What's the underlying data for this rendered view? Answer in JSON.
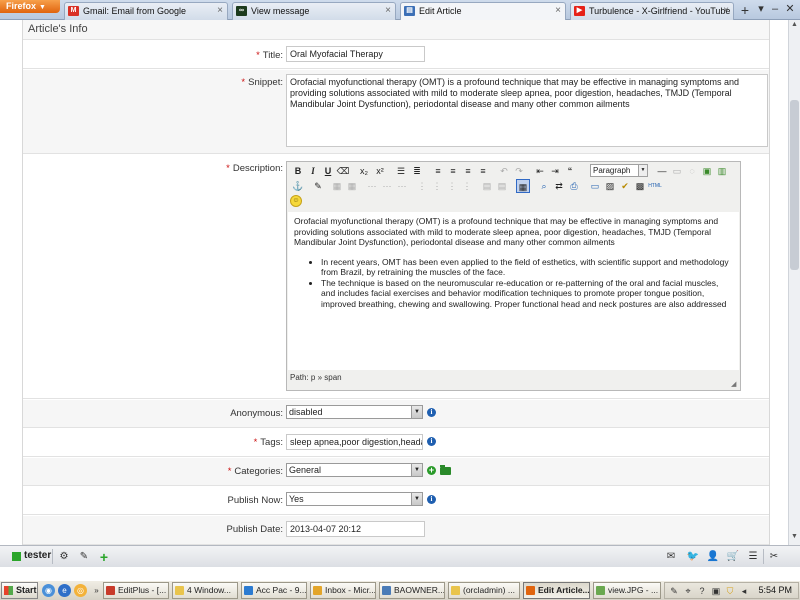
{
  "browser": {
    "menu_label": "Firefox",
    "tabs": [
      {
        "label": "Gmail: Email from Google"
      },
      {
        "label": "View message"
      },
      {
        "label": "Edit Article"
      },
      {
        "label": "Turbulence - X-Girlfriend - YouTube"
      }
    ],
    "new_tab_label": "+"
  },
  "form": {
    "section_title": "Article's Info",
    "required_mark": "*",
    "title": {
      "label": "Title:",
      "value": "Oral Myofacial Therapy"
    },
    "snippet": {
      "label": "Snippet:",
      "value": "Orofacial myofunctional therapy (OMT) is a profound technique that may be effective in managing symptoms and providing solutions associated with mild to moderate sleep apnea, poor digestion, headaches, TMJD (Temporal Mandibular Joint Dysfunction), periodontal disease and many other common ailments"
    },
    "description": {
      "label": "Description:",
      "format_select": "Paragraph",
      "paragraph": "Orofacial myofunctional therapy (OMT) is a profound technique that may be effective in managing symptoms and providing solutions associated with mild to moderate sleep apnea, poor digestion, headaches, TMJD (Temporal Mandibular Joint Dysfunction), periodontal disease and many other common ailments",
      "bullets": [
        "In recent years, OMT has been even applied to the field of esthetics, with scientific support and methodology from Brazil, by retraining the muscles of the face.",
        "The technique is based on the neuromuscular re-education or re-patterning of the oral and facial muscles, and includes facial exercises and behavior modification techniques to promote proper tongue position, improved breathing, chewing and swallowing. Proper functional head and neck postures are also addressed"
      ],
      "path": "Path: p » span"
    },
    "anonymous": {
      "label": "Anonymous:",
      "value": "disabled"
    },
    "tags": {
      "label": "Tags:",
      "value": "sleep apnea,poor digestion,headac"
    },
    "categories": {
      "label": "Categories:",
      "value": "General"
    },
    "publish_now": {
      "label": "Publish Now:",
      "value": "Yes"
    },
    "publish_date": {
      "label": "Publish Date:",
      "value": "2013-04-07 20:12"
    }
  },
  "addon_bar": {
    "user": "tester"
  },
  "taskbar": {
    "start": "Start",
    "items": [
      {
        "label": "EditPlus - [..."
      },
      {
        "label": "4 Window..."
      },
      {
        "label": "Acc Pac - 9..."
      },
      {
        "label": "Inbox - Micr..."
      },
      {
        "label": "BAOWNER..."
      },
      {
        "label": "(orcladmin) ..."
      },
      {
        "label": "Edit Article..."
      },
      {
        "label": "view.JPG - ..."
      }
    ],
    "clock": "5:54 PM"
  },
  "colors": {
    "required": "#cc1111",
    "info": "#1f5fb0",
    "add": "#2a9a2a",
    "firefox_orange": "#e0640e"
  }
}
